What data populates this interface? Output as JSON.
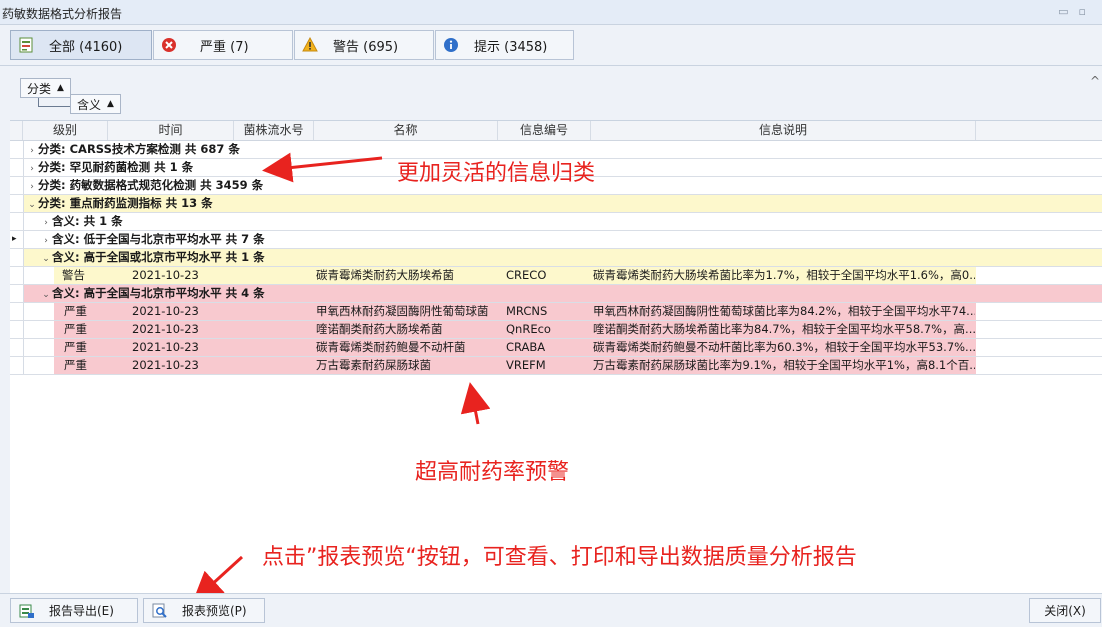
{
  "window": {
    "title": "药敏数据格式分析报告"
  },
  "filter_tabs": [
    {
      "label": "全部 (4160)",
      "icon": "spreadsheet-icon"
    },
    {
      "label": "严重 (7)",
      "icon": "error-icon"
    },
    {
      "label": "警告 (695)",
      "icon": "warning-icon"
    },
    {
      "label": "提示 (3458)",
      "icon": "info-icon"
    }
  ],
  "group_panel": {
    "chip1": "分类",
    "chip2": "含义"
  },
  "columns": [
    "级别",
    "时间",
    "菌株流水号",
    "名称",
    "信息编号",
    "信息说明"
  ],
  "rows": {
    "g1": "分类: CARSS技术方案检测 共 687 条",
    "g2": "分类: 罕见耐药菌检测 共 1 条",
    "g3": "分类: 药敏数据格式规范化检测 共 3459 条",
    "g4": "分类: 重点耐药监测指标 共 13 条",
    "s1": "含义: 共 1 条",
    "s2": "含义: 低于全国与北京市平均水平 共 7 条",
    "s3": "含义: 高于全国或北京市平均水平 共 1 条",
    "s4": "含义: 高于全国与北京市平均水平 共 4 条",
    "yellow_row": {
      "level": "警告",
      "time": "2021-10-23",
      "name": "碳青霉烯类耐药大肠埃希菌",
      "code": "CRECO",
      "desc": "碳青霉烯类耐药大肠埃希菌比率为1.7%，相较于全国平均水平1.6%，高0..."
    },
    "pink_rows": [
      {
        "level": "严重",
        "time": "2021-10-23",
        "name": "甲氧西林耐药凝固酶阴性葡萄球菌",
        "code": "MRCNS",
        "desc": "甲氧西林耐药凝固酶阴性葡萄球菌比率为84.2%，相较于全国平均水平74..."
      },
      {
        "level": "严重",
        "time": "2021-10-23",
        "name": "喹诺酮类耐药大肠埃希菌",
        "code": "QnREco",
        "desc": "喹诺酮类耐药大肠埃希菌比率为84.7%，相较于全国平均水平58.7%，高..."
      },
      {
        "level": "严重",
        "time": "2021-10-23",
        "name": "碳青霉烯类耐药鲍曼不动杆菌",
        "code": "CRABA",
        "desc": "碳青霉烯类耐药鲍曼不动杆菌比率为60.3%，相较于全国平均水平53.7%..."
      },
      {
        "level": "严重",
        "time": "2021-10-23",
        "name": "万古霉素耐药屎肠球菌",
        "code": "VREFM",
        "desc": "万古霉素耐药屎肠球菌比率为9.1%，相较于全国平均水平1%，高8.1个百..."
      }
    ]
  },
  "annotations": {
    "a1": "更加灵活的信息归类",
    "a2": "超高耐药率预警",
    "a3": "点击”报表预览“按钮，可查看、打印和导出数据质量分析报告"
  },
  "footer": {
    "export_label": "报告导出(E)",
    "preview_label": "报表预览(P)",
    "close_label": "关闭(X)"
  },
  "colors": {
    "group_yellow": "#fdf8cc",
    "severe_pink": "#f8c9cf",
    "annotation_red": "#e8231f"
  }
}
